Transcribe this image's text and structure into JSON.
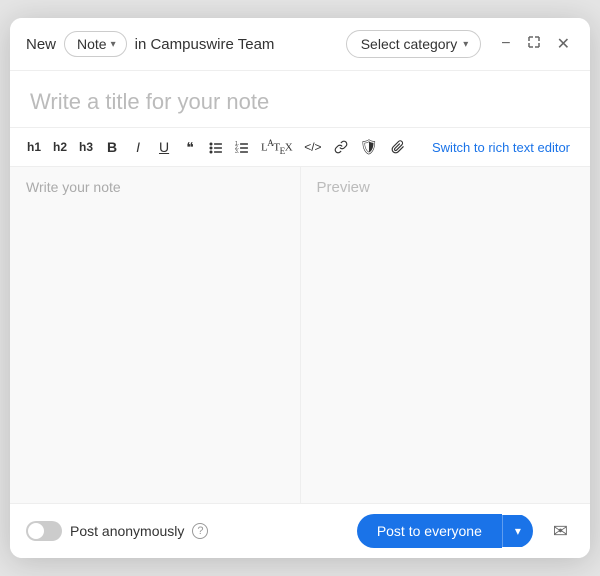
{
  "header": {
    "new_label": "New",
    "note_type": "Note",
    "in_label": "in Campuswire Team",
    "select_category": "Select category",
    "minimize_icon": "−",
    "expand_icon": "⤢",
    "close_icon": "✕"
  },
  "title": {
    "placeholder": "Write a title for your note"
  },
  "toolbar": {
    "h1": "h1",
    "h2": "h2",
    "h3": "h3",
    "bold": "B",
    "italic": "I",
    "underline": "U",
    "quote": "❝",
    "bullet_list": "≡",
    "ordered_list": "≡",
    "latex": "LATEX",
    "code": "</>",
    "link": "🔗",
    "shield": "🛡",
    "attach": "📎",
    "switch_editor": "Switch to rich text editor"
  },
  "editor": {
    "placeholder": "Write your note",
    "preview_label": "Preview"
  },
  "footer": {
    "post_anon_label": "Post anonymously",
    "help_tooltip": "?",
    "post_button": "Post to everyone",
    "mail_icon": "✉"
  }
}
